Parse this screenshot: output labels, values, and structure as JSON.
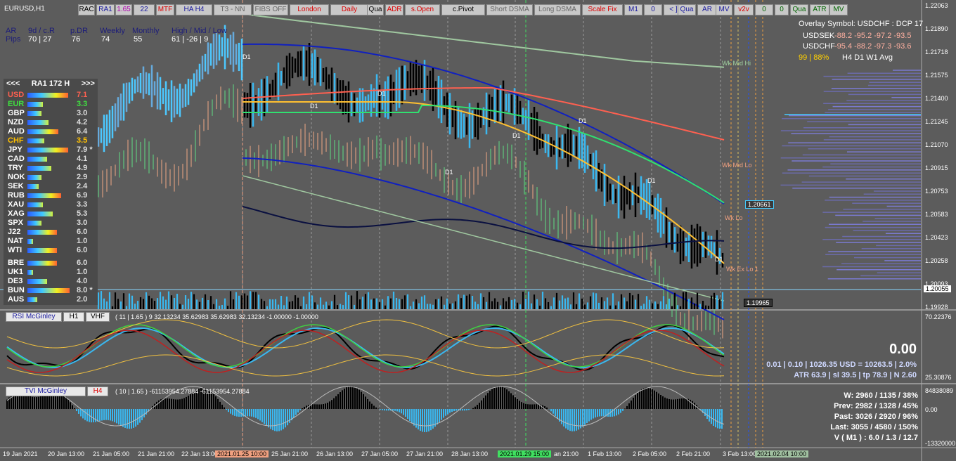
{
  "symbol": "EURUSD,H1",
  "toolbar": [
    "RAC",
    "RA1",
    "1.65",
    "22",
    "MTF",
    "HA H4",
    "T3 - NN",
    "FIBS OFF",
    "London",
    "Daily",
    "Qua",
    "ADR",
    "s.Open",
    "c.Pivot",
    "Short DSMA",
    "Long DSMA",
    "Scale Fix",
    "M1",
    "0",
    "< ]",
    "Qua",
    "AR",
    "MV",
    "v2v",
    "0",
    "0",
    "Qua",
    "ATR",
    "MV"
  ],
  "info": {
    "ar": "AR",
    "pips": "Pips",
    "h1": "9d / c.R",
    "v1": "70 | 27",
    "h2": "p.DR",
    "v2": "76",
    "h3": "Weekly",
    "v3": "74",
    "h4": "Monthly",
    "v4": "55",
    "h5": "High / Mid / Low",
    "v5": "61 | -26 | 9"
  },
  "strength": {
    "title": "RA1  172  H",
    "prev": "<<<",
    "next": ">>>",
    "rows": [
      {
        "c": "USD",
        "v": "7.1",
        "color": "#ff6050"
      },
      {
        "c": "EUR",
        "v": "3.3",
        "color": "#40e040"
      },
      {
        "c": "GBP",
        "v": "3.0",
        "color": "#ffffff"
      },
      {
        "c": "NZD",
        "v": "4.2",
        "color": "#ffffff"
      },
      {
        "c": "AUD",
        "v": "6.4",
        "color": "#ffffff"
      },
      {
        "c": "CHF",
        "v": "3.5",
        "color": "#ffc000"
      },
      {
        "c": "JPY",
        "v": "7.9 *",
        "color": "#ffffff"
      },
      {
        "c": "CAD",
        "v": "4.1",
        "color": "#ffffff"
      },
      {
        "c": "TRY",
        "v": "4.9",
        "color": "#ffffff"
      },
      {
        "c": "NOK",
        "v": "2.9",
        "color": "#ffffff"
      },
      {
        "c": "SEK",
        "v": "2.4",
        "color": "#ffffff"
      },
      {
        "c": "RUB",
        "v": "6.9",
        "color": "#ffffff"
      },
      {
        "c": "XAU",
        "v": "3.3",
        "color": "#ffffff"
      },
      {
        "c": "XAG",
        "v": "5.3",
        "color": "#ffffff"
      },
      {
        "c": "SPX",
        "v": "3.0",
        "color": "#ffffff"
      },
      {
        "c": "J22",
        "v": "6.0",
        "color": "#ffffff"
      },
      {
        "c": "NAT",
        "v": "1.0",
        "color": "#ffffff"
      },
      {
        "c": "WTI",
        "v": "6.0",
        "color": "#ffffff"
      },
      {
        "c": "BRE",
        "v": "6.0",
        "color": "#ffffff"
      },
      {
        "c": "UK1",
        "v": "1.0",
        "color": "#ffffff"
      },
      {
        "c": "DE3",
        "v": "4.0",
        "color": "#ffffff"
      },
      {
        "c": "BUN",
        "v": "8.0 *",
        "color": "#ffffff"
      },
      {
        "c": "AUS",
        "v": "2.0",
        "color": "#ffffff"
      }
    ]
  },
  "overlay": {
    "title": "Overlay Symbol: USDCHF : DCP 17",
    "sek_label": "USDSEK",
    "sek_vals": "-88.2  -95.2  -97.2  -93.5",
    "chf_label": "USDCHF",
    "chf_vals": "-95.4  -88.2  -97.3  -93.6",
    "pct": "99 | 88%",
    "tf": "H4     D1     W1    Avg"
  },
  "price_axis": [
    "1.22063",
    "1.21890",
    "1.21718",
    "1.21575",
    "1.21400",
    "1.21245",
    "1.21070",
    "1.20915",
    "1.20753",
    "1.20583",
    "1.20423",
    "1.20258",
    "1.20093",
    "1.19928"
  ],
  "price_tags": {
    "current": "1.20055",
    "line1": "1.20661",
    "line2": "1.19965"
  },
  "chart_labels": {
    "wk_mid_hi": "Wk Mid Hi",
    "wk_mid_lo": "Wk Mid Lo",
    "wk_lo": "Wk Lo",
    "wk_ex_lo": "Wk Ex Lo 1",
    "d1": "D1"
  },
  "rsi": {
    "name": "RSI McGinley",
    "tf": "H1",
    "extra": "VHF",
    "params": "( 11 | 1.65 ) 9 32.13234 35.62983 35.62983 32.13234 -1.00000 -1.00000",
    "scale_top": "70.22376",
    "scale_bot": "25.30876",
    "big": "0.00",
    "line1": "0.01  |  0.10  |  1026.35 USD = 10263.5  |  2.0%",
    "line2": "ATR 63.9  | sl 39.5  |  tp 78.9  |  N 2.60"
  },
  "tvi": {
    "name": "TVI McGinley",
    "tf": "H4",
    "params": "( 10 | 1.65 ) -61153954.27884 -61153954.27884",
    "scale_top": "84838089",
    "scale_mid": "0.00",
    "scale_bot": "-13320000",
    "w": "W: 2960 / 1135 / 38%",
    "prev": "Prev: 2982 / 1328 / 45%",
    "past": "Past: 3026 / 2920 / 96%",
    "last": "Last: 3055 / 4580 / 150%",
    "v": "V ( M1 ) : 6.0 / 1.3 / 12.7"
  },
  "time_axis": [
    "19 Jan 2021",
    "20 Jan 13:00",
    "21 Jan 05:00",
    "21 Jan 21:00",
    "22 Jan 13:00",
    "2021.01.25 10:00",
    "25 Jan 21:00",
    "26 Jan 13:00",
    "27 Jan 05:00",
    "27 Jan 21:00",
    "28 Jan 13:00",
    "2021.01.29 15:00",
    "an 21:00",
    "1 Feb 13:00",
    "2 Feb 05:00",
    "2 Feb 21:00",
    "3 Feb 13:00",
    "2021.02.04 10:00"
  ]
}
